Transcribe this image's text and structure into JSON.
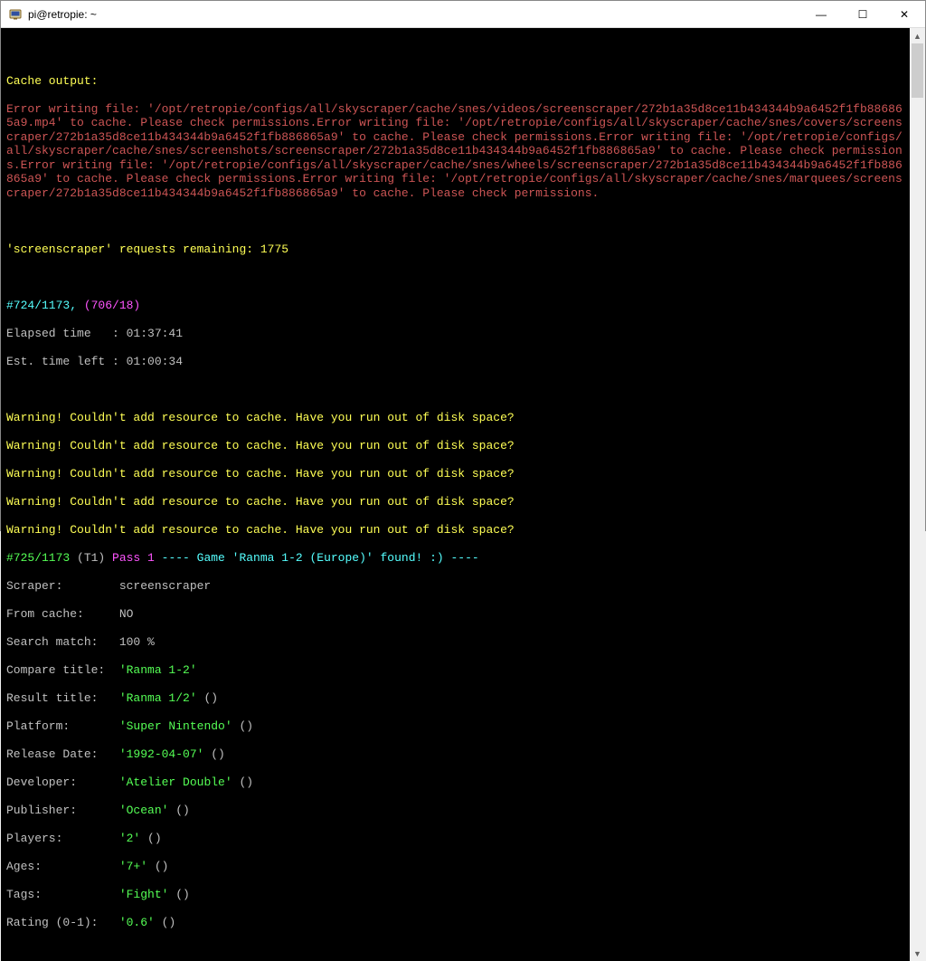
{
  "window": {
    "title": "pi@retropie: ~"
  },
  "titlebar_buttons": {
    "minimize": "—",
    "maximize": "☐",
    "close": "✕"
  },
  "cache_header": "Cache output:",
  "cache_text": "Error writing file: '/opt/retropie/configs/all/skyscraper/cache/snes/videos/screenscraper/272b1a35d8ce11b434344b9a6452f1fb886865a9.mp4' to cache. Please check permissions.Error writing file: '/opt/retropie/configs/all/skyscraper/cache/snes/covers/screenscraper/272b1a35d8ce11b434344b9a6452f1fb886865a9' to cache. Please check permissions.Error writing file: '/opt/retropie/configs/all/skyscraper/cache/snes/screenshots/screenscraper/272b1a35d8ce11b434344b9a6452f1fb886865a9' to cache. Please check permissions.Error writing file: '/opt/retropie/configs/all/skyscraper/cache/snes/wheels/screenscraper/272b1a35d8ce11b434344b9a6452f1fb886865a9' to cache. Please check permissions.Error writing file: '/opt/retropie/configs/all/skyscraper/cache/snes/marquees/screenscraper/272b1a35d8ce11b434344b9a6452f1fb886865a9' to cache. Please check permissions.",
  "requests": "'screenscraper' requests remaining: 1775",
  "progress1": {
    "counter": "#724/1173,",
    "paren": " (706/18)"
  },
  "timing": {
    "elapsed": "Elapsed time   : 01:37:41",
    "est": "Est. time left : 01:00:34"
  },
  "warnings": [
    "Warning! Couldn't add resource to cache. Have you run out of disk space?",
    "Warning! Couldn't add resource to cache. Have you run out of disk space?",
    "Warning! Couldn't add resource to cache. Have you run out of disk space?",
    "Warning! Couldn't add resource to cache. Have you run out of disk space?",
    "Warning! Couldn't add resource to cache. Have you run out of disk space?"
  ],
  "found": {
    "counter": "#725/1173",
    "thread": " (T1) ",
    "pass": "Pass 1",
    "msg": " ---- Game 'Ranma 1-2 (Europe)' found! :) ----"
  },
  "fields": {
    "scraper": "Scraper:        screenscraper",
    "fromcache": "From cache:     NO",
    "searchmatch": "Search match:   100 %",
    "ctlabel": "Compare title:  ",
    "ctval": "'Ranma 1-2'",
    "rtlabel": "Result title:   ",
    "rtval": "'Ranma 1/2'",
    "rtparen": " ()",
    "pflabel": "Platform:       ",
    "pfval": "'Super Nintendo'",
    "pfparen": " ()",
    "rdlabel": "Release Date:   ",
    "rdval": "'1992-04-07'",
    "rdparen": " ()",
    "devlabel": "Developer:      ",
    "devval": "'Atelier Double'",
    "devparen": " ()",
    "publabel": "Publisher:      ",
    "pubval": "'Ocean'",
    "pubparen": " ()",
    "pllabel": "Players:        ",
    "plval": "'2'",
    "plparen": " ()",
    "aglabel": "Ages:           ",
    "agval": "'7+'",
    "agparen": " ()",
    "tglabel": "Tags:           ",
    "tgval": "'Fight'",
    "tgparen": " ()",
    "ratlabel": "Rating (0-1):   ",
    "ratval": "'0.6'",
    "ratparen": " ()"
  }
}
